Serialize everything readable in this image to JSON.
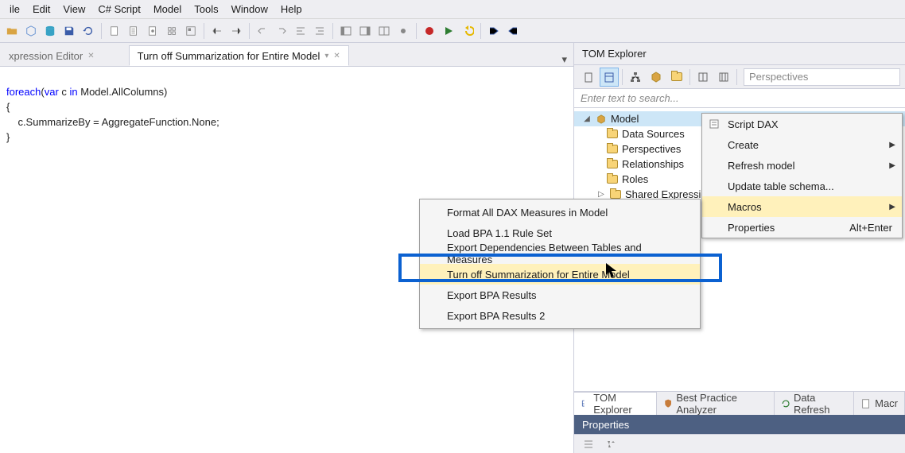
{
  "menubar": [
    "ile",
    "Edit",
    "View",
    "C# Script",
    "Model",
    "Tools",
    "Window",
    "Help"
  ],
  "tabs": {
    "ghost": "xpression Editor",
    "active": "Turn off Summarization for Entire Model"
  },
  "code": {
    "l1a": "foreach",
    "l1b": "(",
    "l1c": "var",
    "l1d": " c ",
    "l1e": "in",
    "l1f": " Model.AllColumns)",
    "l2": "{",
    "l3": "    c.SummarizeBy = AggregateFunction.None;",
    "l4": "}"
  },
  "tom": {
    "title": "TOM Explorer",
    "persp_placeholder": "Perspectives",
    "search_placeholder": "Enter text to search...",
    "tree": {
      "root": "Model",
      "items": [
        "Data Sources",
        "Perspectives",
        "Relationships",
        "Roles",
        "Shared Expressio"
      ]
    },
    "bottom_tabs": [
      "TOM Explorer",
      "Best Practice Analyzer",
      "Data Refresh",
      "Macr"
    ],
    "props_title": "Properties"
  },
  "ctx_model": {
    "items": [
      {
        "label": "Script DAX",
        "icon": true
      },
      {
        "label": "Create",
        "submenu": true
      },
      {
        "label": "Refresh model",
        "submenu": true
      },
      {
        "label": "Update table schema..."
      },
      {
        "label": "Macros",
        "submenu": true,
        "highlight": true
      },
      {
        "label": "Properties",
        "shortcut": "Alt+Enter"
      }
    ]
  },
  "ctx_macros": {
    "items": [
      {
        "label": "Format All DAX Measures in Model"
      },
      {
        "label": "Load BPA 1.1 Rule Set"
      },
      {
        "label": "Export Dependencies Between Tables and Measures"
      },
      {
        "label": "Turn off Summarization for Entire Model",
        "highlight": true
      },
      {
        "label": "Export BPA Results"
      },
      {
        "label": "Export BPA Results 2"
      }
    ]
  }
}
